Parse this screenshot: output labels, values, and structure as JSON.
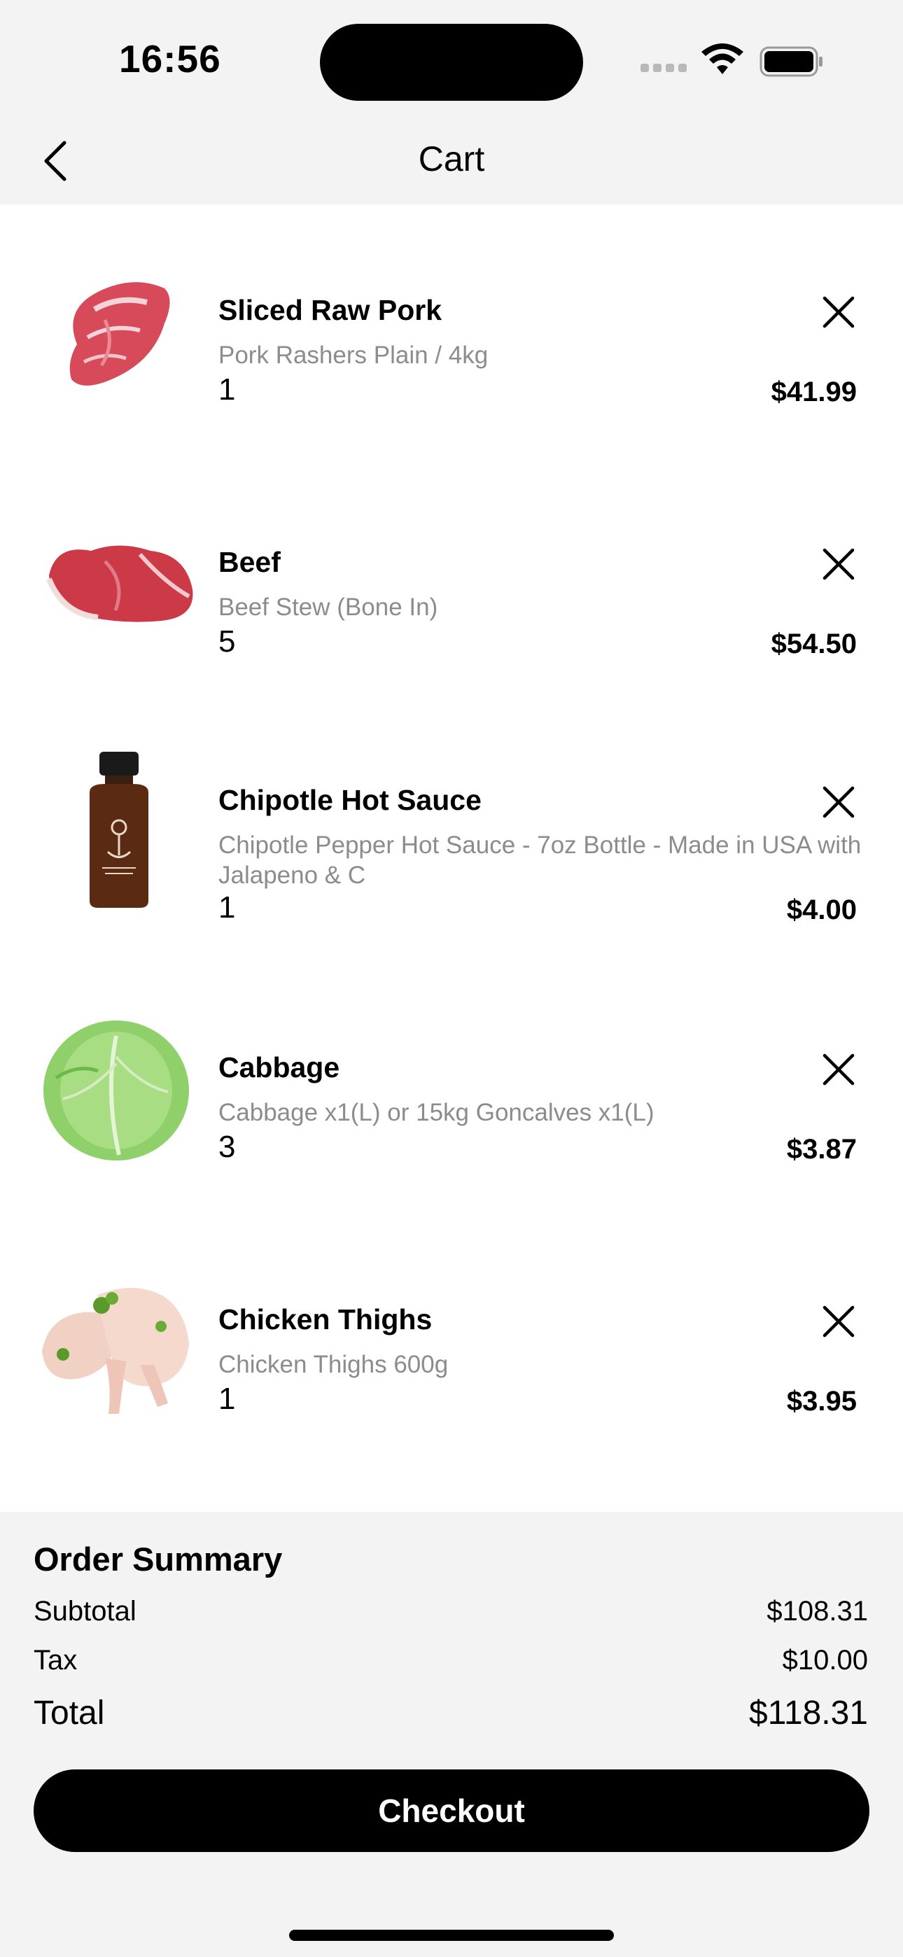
{
  "status": {
    "time": "16:56"
  },
  "nav": {
    "title": "Cart"
  },
  "items": [
    {
      "name": "Sliced Raw Pork",
      "desc": "Pork Rashers Plain / 4kg",
      "qty": "1",
      "price": "$41.99"
    },
    {
      "name": "Beef",
      "desc": "Beef Stew (Bone In)",
      "qty": "5",
      "price": "$54.50"
    },
    {
      "name": "Chipotle Hot Sauce",
      "desc": "Chipotle Pepper Hot Sauce - 7oz Bottle - Made in USA with Jalapeno & C",
      "qty": "1",
      "price": "$4.00"
    },
    {
      "name": "Cabbage",
      "desc": "Cabbage x1(L) or 15kg Goncalves x1(L)",
      "qty": "3",
      "price": "$3.87"
    },
    {
      "name": "Chicken Thighs",
      "desc": "Chicken Thighs 600g",
      "qty": "1",
      "price": "$3.95"
    }
  ],
  "summary": {
    "title": "Order Summary",
    "subtotal_label": "Subtotal",
    "subtotal": "$108.31",
    "tax_label": "Tax",
    "tax": "$10.00",
    "total_label": "Total",
    "total": "$118.31",
    "checkout_label": "Checkout"
  },
  "icons": {
    "back": "chevron-left-icon",
    "remove": "close-icon",
    "wifi": "wifi-icon",
    "battery": "battery-icon"
  }
}
